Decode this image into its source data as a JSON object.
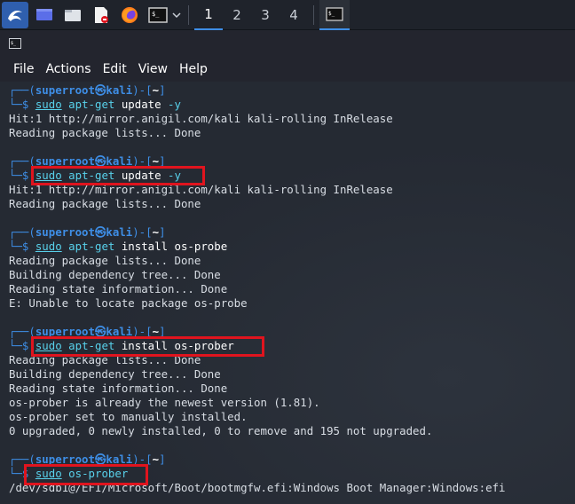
{
  "taskbar": {
    "icons": [
      "kali-menu-icon",
      "desktop-icon",
      "file-manager-icon",
      "text-editor-icon",
      "firefox-icon",
      "terminal-icon",
      "chevron-down-icon"
    ],
    "workspaces": [
      "1",
      "2",
      "3",
      "4"
    ],
    "active_workspace": "1"
  },
  "window": {
    "menu": [
      "File",
      "Actions",
      "Edit",
      "View",
      "Help"
    ]
  },
  "prompt": {
    "box_open": "┌──(",
    "user": "superroot㉿kali",
    "mid": ")-[",
    "path": "~",
    "close": "]",
    "cmd_prefix": "└─$ "
  },
  "commands": [
    {
      "sudo": "sudo",
      "tool": "apt-get",
      "rest": " update",
      "flag": " -y"
    },
    {
      "sudo": "sudo",
      "tool": "apt-get",
      "rest": " update",
      "flag": " -y"
    },
    {
      "sudo": "sudo",
      "tool": "apt-get",
      "rest": " install os-probe",
      "flag": ""
    },
    {
      "sudo": "sudo",
      "tool": "apt-get",
      "rest": " install os-prober",
      "flag": ""
    },
    {
      "sudo": "sudo",
      "tool": "os-prober",
      "rest": "",
      "flag": ""
    }
  ],
  "output": {
    "block1": [
      "Hit:1 http://mirror.anigil.com/kali kali-rolling InRelease",
      "Reading package lists... Done"
    ],
    "block2": [
      "Hit:1 http://mirror.anigil.com/kali kali-rolling InRelease",
      "Reading package lists... Done"
    ],
    "block3": [
      "Reading package lists... Done",
      "Building dependency tree... Done",
      "Reading state information... Done",
      "E: Unable to locate package os-probe"
    ],
    "block4": [
      "Reading package lists... Done",
      "Building dependency tree... Done",
      "Reading state information... Done",
      "os-prober is already the newest version (1.81).",
      "os-prober set to manually installed.",
      "0 upgraded, 0 newly installed, 0 to remove and 195 not upgraded."
    ],
    "block5": [
      "/dev/sdb1@/EFI/Microsoft/Boot/bootmgfw.efi:Windows Boot Manager:Windows:efi"
    ]
  },
  "colors": {
    "accent": "#3e8ee6",
    "highlight": "#e0141e",
    "command": "#58d1eb"
  }
}
